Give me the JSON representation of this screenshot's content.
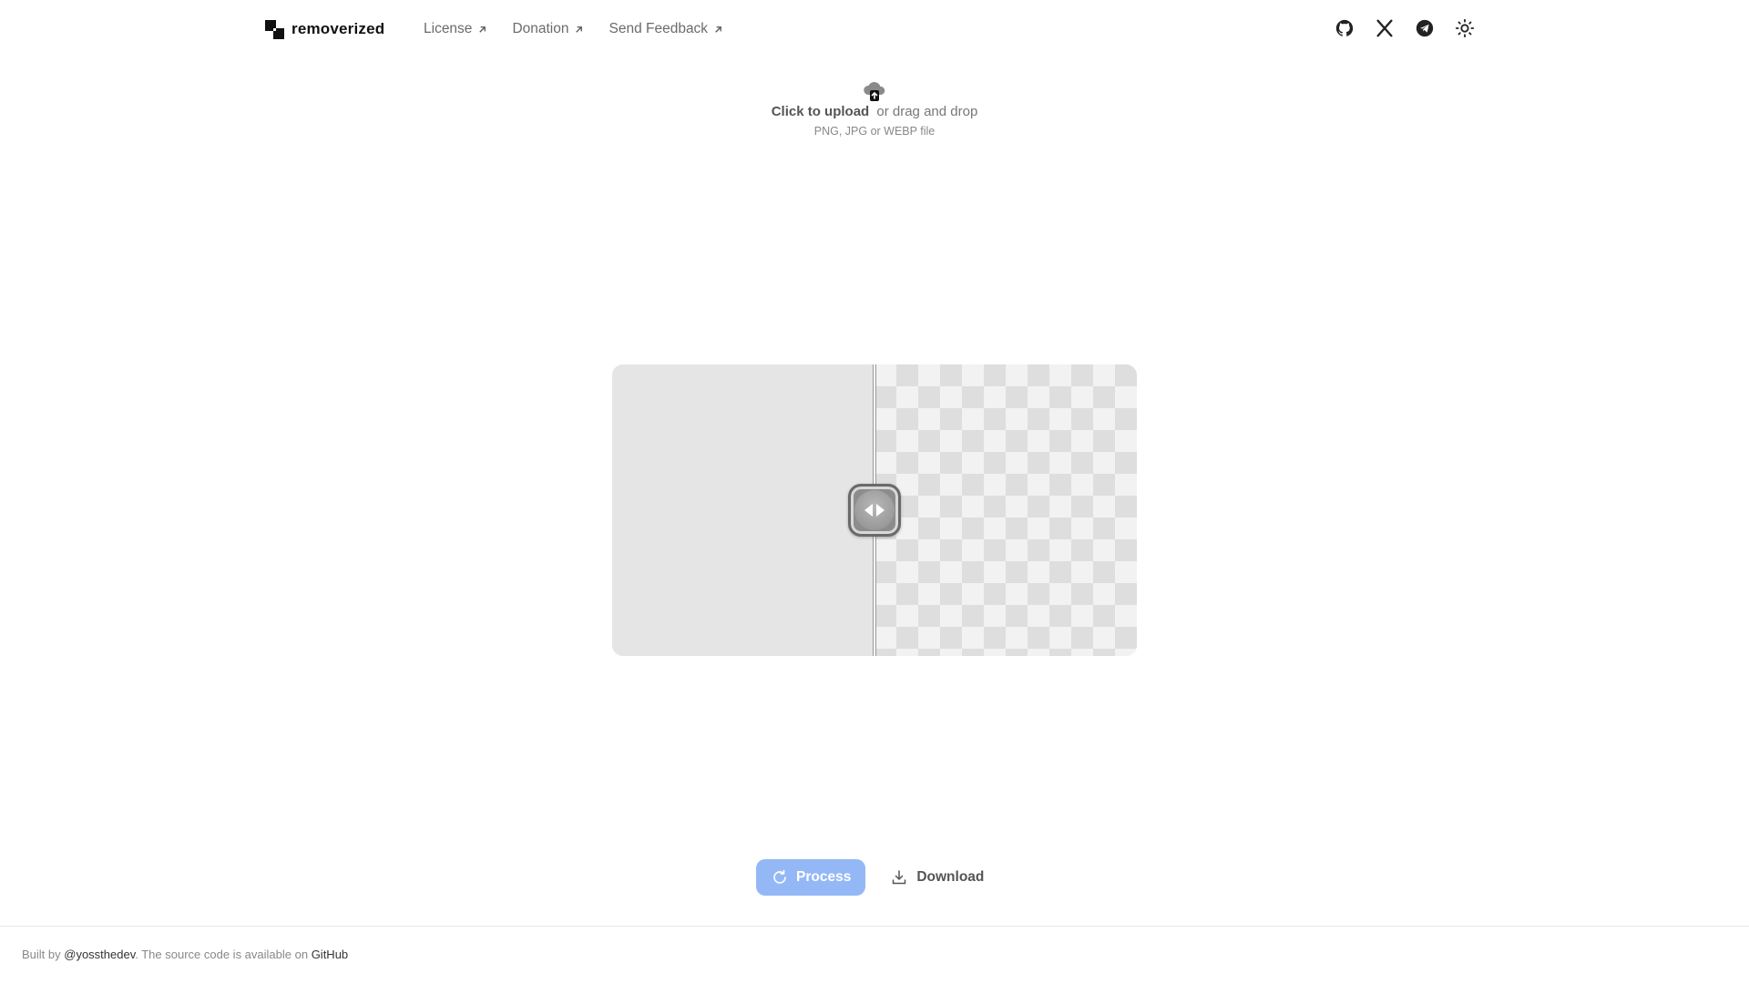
{
  "brand": {
    "name": "removerized",
    "logo_icon": "squares-logo-icon"
  },
  "nav": [
    {
      "label": "License",
      "icon": "arrow-up-right-icon"
    },
    {
      "label": "Donation",
      "icon": "arrow-up-right-icon"
    },
    {
      "label": "Send Feedback",
      "icon": "arrow-up-right-icon"
    }
  ],
  "header_icons": [
    "github-icon",
    "x-icon",
    "telegram-icon",
    "sun-icon"
  ],
  "upload": {
    "icon": "cloud-upload-icon",
    "primary": "Click to upload",
    "secondary": "or drag and drop",
    "hint": "PNG, JPG or WEBP file"
  },
  "compare": {
    "split_fraction": 0.5,
    "handle_icon": "left-right-arrows-icon"
  },
  "actions": {
    "process_label": "Process",
    "process_icon": "refresh-icon",
    "download_label": "Download",
    "download_icon": "download-icon"
  },
  "footer": {
    "prefix": "Built by ",
    "author": "@yossthedev",
    "middle": ". The source code is available on ",
    "repo": "GitHub"
  },
  "colors": {
    "accent": "#93b8f5",
    "text_muted": "#6b6b6b"
  }
}
